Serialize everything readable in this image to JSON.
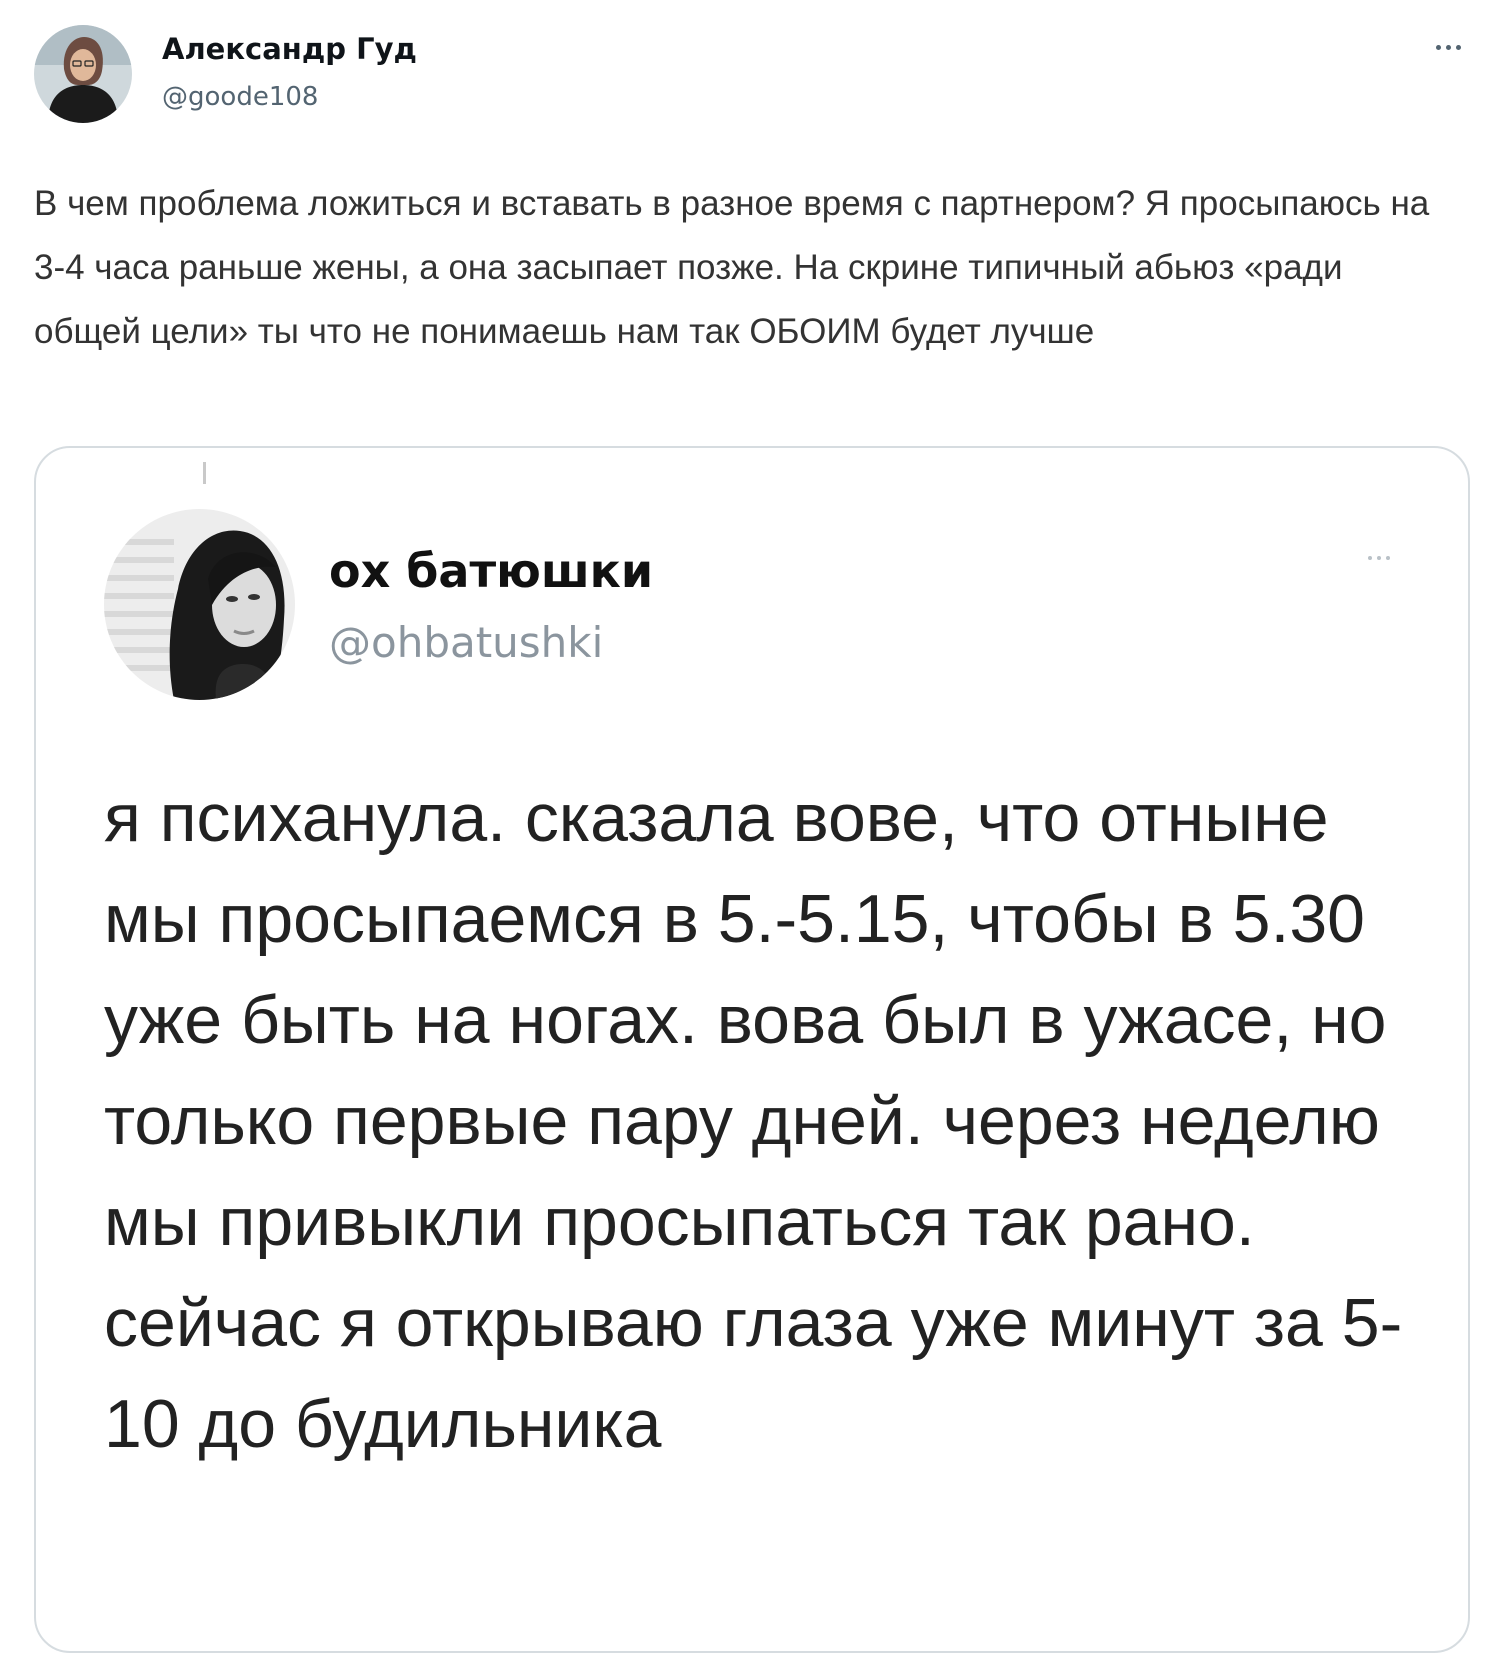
{
  "tweet": {
    "author_name": "Александр Гуд",
    "author_handle": "@goode108",
    "text": "В чем проблема ложиться и вставать в разное время с партнером? Я просыпаюсь на 3-4 часа раньше жены, а она засыпает позже. На скрине типичный абьюз «ради общей цели» ты что не понимаешь нам так ОБОИМ будет лучше",
    "more_icon": "more-horizontal-icon"
  },
  "quoted_tweet": {
    "author_name": "ох батюшки",
    "author_handle": "@ohbatushki",
    "text": "я психанула. сказала вове, что отныне мы просыпаемся в 5.-5.15, чтобы в 5.30 уже быть на ногах. вова был в ужасе, но только первые пару дней. через неделю мы привыкли просыпаться так рано. сейчас я открываю глаза уже минут за 5-10 до будильника",
    "more_icon": "more-horizontal-icon"
  },
  "colors": {
    "text_primary": "#0f1419",
    "text_secondary": "#536471",
    "card_border": "#d6dce0"
  }
}
